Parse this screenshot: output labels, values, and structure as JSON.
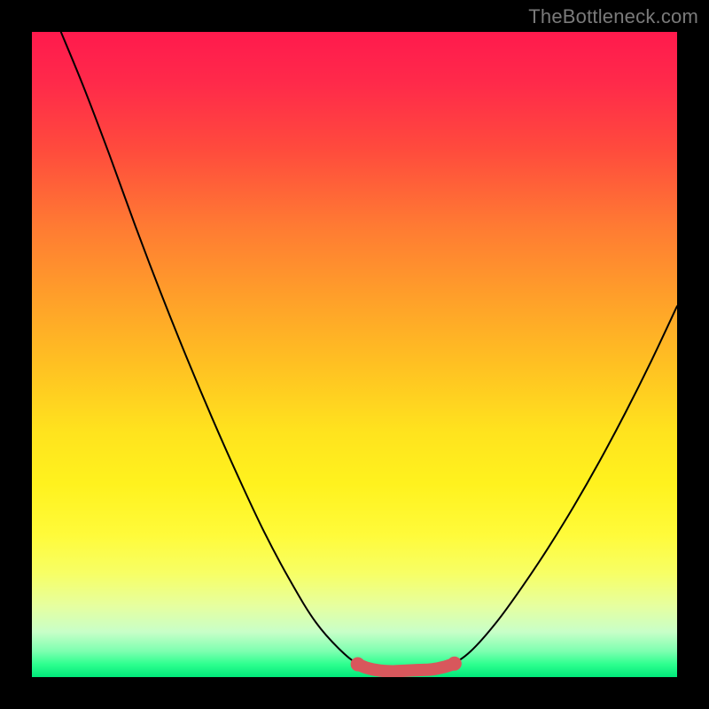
{
  "attribution": "TheBottleneck.com",
  "chart_data": {
    "type": "line",
    "title": "",
    "xlabel": "",
    "ylabel": "",
    "xlim": [
      0,
      1
    ],
    "ylim": [
      0,
      1
    ],
    "gradient_stops": [
      {
        "pos": 0.0,
        "color": "#ff1a4d"
      },
      {
        "pos": 0.3,
        "color": "#ff7a33"
      },
      {
        "pos": 0.62,
        "color": "#ffe31e"
      },
      {
        "pos": 0.93,
        "color": "#c8ffc8"
      },
      {
        "pos": 1.0,
        "color": "#00e87a"
      }
    ],
    "series": [
      {
        "name": "bottleneck_curve",
        "color": "#000000",
        "points": [
          {
            "x": 0.045,
            "y": 1.0
          },
          {
            "x": 0.08,
            "y": 0.915
          },
          {
            "x": 0.12,
            "y": 0.81
          },
          {
            "x": 0.16,
            "y": 0.7
          },
          {
            "x": 0.2,
            "y": 0.595
          },
          {
            "x": 0.24,
            "y": 0.495
          },
          {
            "x": 0.28,
            "y": 0.4
          },
          {
            "x": 0.32,
            "y": 0.31
          },
          {
            "x": 0.36,
            "y": 0.225
          },
          {
            "x": 0.4,
            "y": 0.15
          },
          {
            "x": 0.44,
            "y": 0.085
          },
          {
            "x": 0.48,
            "y": 0.04
          },
          {
            "x": 0.51,
            "y": 0.018
          },
          {
            "x": 0.54,
            "y": 0.01
          },
          {
            "x": 0.58,
            "y": 0.01
          },
          {
            "x": 0.62,
            "y": 0.012
          },
          {
            "x": 0.65,
            "y": 0.02
          },
          {
            "x": 0.68,
            "y": 0.04
          },
          {
            "x": 0.72,
            "y": 0.085
          },
          {
            "x": 0.76,
            "y": 0.14
          },
          {
            "x": 0.8,
            "y": 0.2
          },
          {
            "x": 0.84,
            "y": 0.265
          },
          {
            "x": 0.88,
            "y": 0.335
          },
          {
            "x": 0.92,
            "y": 0.41
          },
          {
            "x": 0.96,
            "y": 0.49
          },
          {
            "x": 1.0,
            "y": 0.575
          }
        ]
      },
      {
        "name": "bottom_highlight",
        "color": "#d8575c",
        "stroke_width": 14,
        "points": [
          {
            "x": 0.505,
            "y": 0.02
          },
          {
            "x": 0.52,
            "y": 0.014
          },
          {
            "x": 0.54,
            "y": 0.01
          },
          {
            "x": 0.56,
            "y": 0.009
          },
          {
            "x": 0.58,
            "y": 0.01
          },
          {
            "x": 0.6,
            "y": 0.011
          },
          {
            "x": 0.62,
            "y": 0.012
          },
          {
            "x": 0.64,
            "y": 0.016
          },
          {
            "x": 0.655,
            "y": 0.021
          }
        ]
      }
    ],
    "highlight_endpoints": [
      {
        "x": 0.505,
        "y": 0.02
      },
      {
        "x": 0.655,
        "y": 0.021
      }
    ]
  }
}
